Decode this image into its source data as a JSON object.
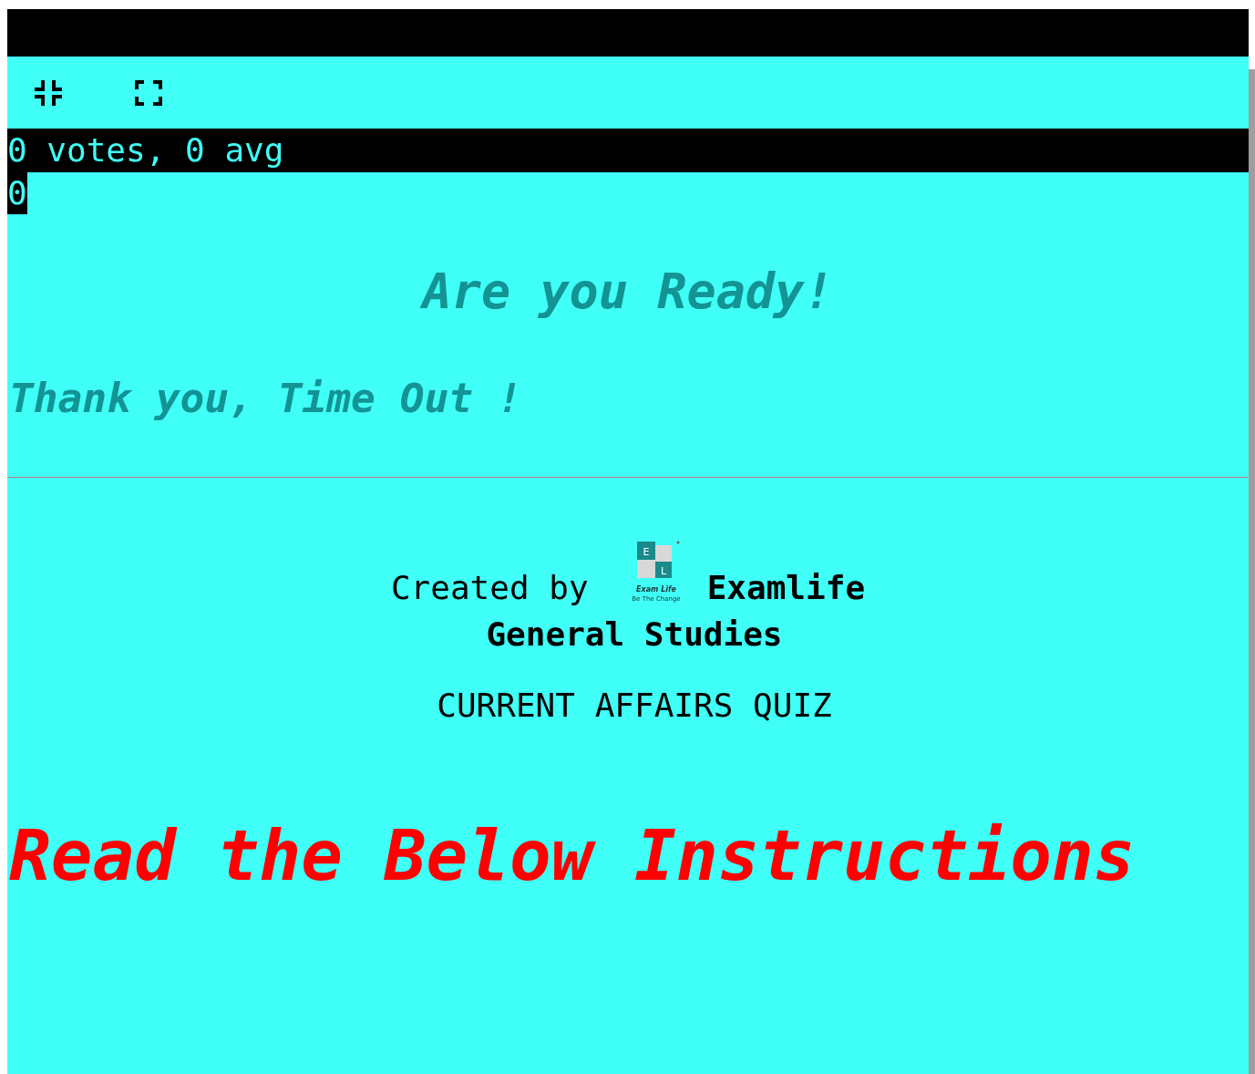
{
  "rating": {
    "summary": "0 votes, 0 avg",
    "count": "0"
  },
  "heading": "Are you Ready!",
  "timeout_message": "Thank you, Time Out !",
  "credits": {
    "label": "Created by",
    "logo": {
      "letters": [
        "E",
        "L"
      ],
      "name": "Exam Life",
      "tagline": "Be The Change"
    },
    "brand": "Examlife",
    "subject": "General Studies"
  },
  "quiz_title": "CURRENT AFFAIRS QUIZ",
  "instructions_heading": "Read the Below Instructions"
}
